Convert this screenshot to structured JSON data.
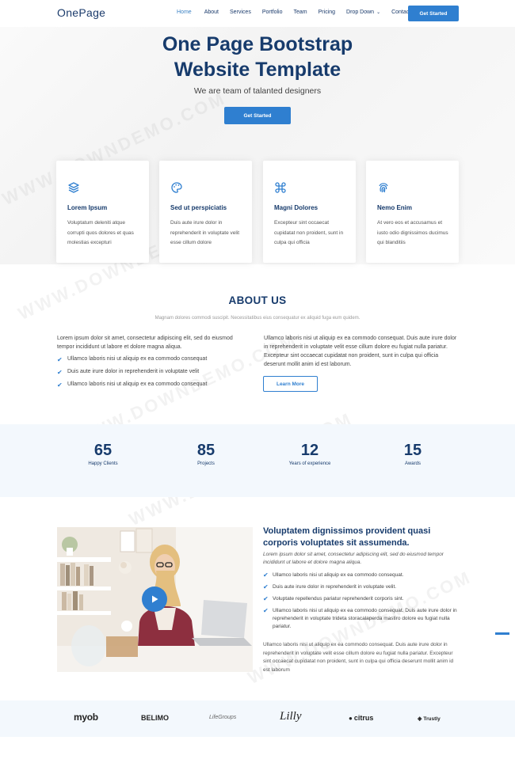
{
  "header": {
    "logo": "OnePage",
    "nav": [
      {
        "label": "Home",
        "active": true
      },
      {
        "label": "About"
      },
      {
        "label": "Services"
      },
      {
        "label": "Portfolio"
      },
      {
        "label": "Team"
      },
      {
        "label": "Pricing"
      },
      {
        "label": "Drop Down",
        "dropdown": true
      },
      {
        "label": "Contact"
      }
    ],
    "cta": "Get Started"
  },
  "hero": {
    "title_line1": "One Page Bootstrap",
    "title_line2": "Website Template",
    "subtitle": "We are team of talanted designers",
    "button": "Get Started"
  },
  "features": [
    {
      "icon": "layers-icon",
      "title": "Lorem Ipsum",
      "desc": "Voluptatum deleniti atque corrupti quos dolores et quas molestias excepturi"
    },
    {
      "icon": "palette-icon",
      "title": "Sed ut perspiciatis",
      "desc": "Duis aute irure dolor in reprehenderit in voluptate velit esse cillum dolore"
    },
    {
      "icon": "command-icon",
      "title": "Magni Dolores",
      "desc": "Excepteur sint occaecat cupidatat non proident, sunt in culpa qui officia"
    },
    {
      "icon": "fingerprint-icon",
      "title": "Nemo Enim",
      "desc": "At vero eos et accusamus et iusto odio dignissimos ducimus qui blanditiis"
    }
  ],
  "about": {
    "title": "ABOUT US",
    "subtitle": "Magnam dolores commodi suscipit. Necessitatibus eius consequatur ex aliquid fuga eum quidem.",
    "left_intro": "Lorem ipsum dolor sit amet, consectetur adipiscing elit, sed do eiusmod tempor incididunt ut labore et dolore magna aliqua.",
    "checks": [
      "Ullamco laboris nisi ut aliquip ex ea commodo consequat",
      "Duis aute irure dolor in reprehenderit in voluptate velit",
      "Ullamco laboris nisi ut aliquip ex ea commodo consequat"
    ],
    "right_text": "Ullamco laboris nisi ut aliquip ex ea commodo consequat. Duis aute irure dolor in reprehenderit in voluptate velit esse cillum dolore eu fugiat nulla pariatur. Excepteur sint occaecat cupidatat non proident, sunt in culpa qui officia deserunt mollit anim id est laborum.",
    "button": "Learn More"
  },
  "counts": [
    {
      "num": "65",
      "label": "Happy Clients"
    },
    {
      "num": "85",
      "label": "Projects"
    },
    {
      "num": "12",
      "label": "Years of experience"
    },
    {
      "num": "15",
      "label": "Awards"
    }
  ],
  "video_section": {
    "title": "Voluptatem dignissimos provident quasi corporis voluptates sit assumenda.",
    "subtitle": "Lorem ipsum dolor sit amet, consectetur adipiscing elit, sed do eiusmod tempor incididunt ut labore et dolore magna aliqua.",
    "checks": [
      "Ullamco laboris nisi ut aliquip ex ea commodo consequat.",
      "Duis aute irure dolor in reprehenderit in voluptate velit.",
      "Voluptate repellendus pariatur reprehenderit corporis sint.",
      "Ullamco laboris nisi ut aliquip ex ea commodo consequat. Duis aute irure dolor in reprehenderit in voluptate trideta storacalaperda mastiro dolore eu fugiat nulla pariatur."
    ],
    "paragraph": "Ullamco laboris nisi ut aliquip ex ea commodo consequat. Duis aute irure dolor in reprehenderit in voluptate velit esse cillum dolore eu fugiat nulla pariatur. Excepteur sint occaecat cupidatat non proident, sunt in culpa qui officia deserunt mollit anim id est laborum"
  },
  "clients": [
    "myob",
    "BELIMO",
    "LifeGroups",
    "Lilly",
    "citrus",
    "Trustly"
  ],
  "watermark": "WWW.DOWNDEMO.COM",
  "colors": {
    "accent": "#2f7fd0",
    "heading": "#173b6c"
  }
}
